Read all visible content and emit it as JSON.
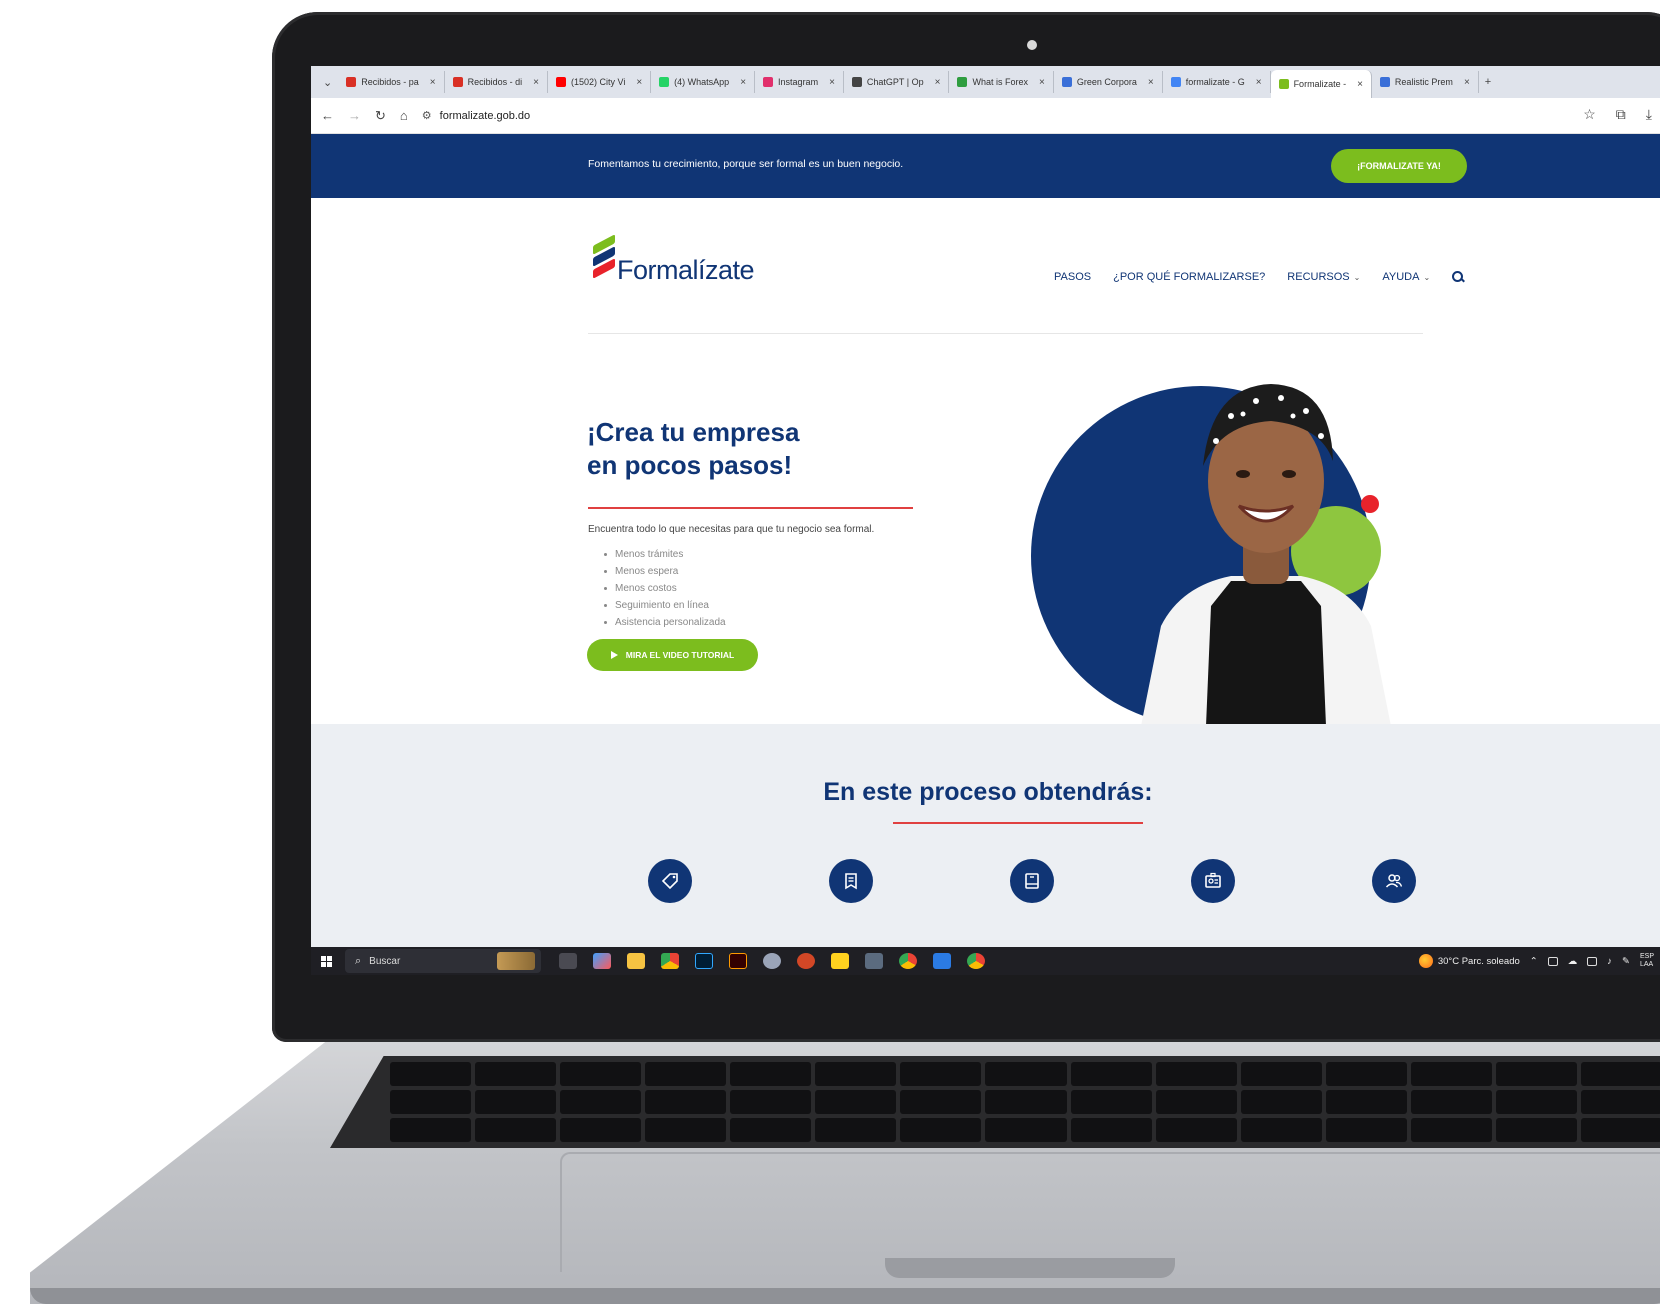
{
  "browser": {
    "tabs": [
      {
        "label": "Recibidos - pa",
        "color": "#d93025"
      },
      {
        "label": "Recibidos - di",
        "color": "#d93025"
      },
      {
        "label": "(1502) City Vi",
        "color": "#ff0000"
      },
      {
        "label": "(4) WhatsApp",
        "color": "#25d366"
      },
      {
        "label": "Instagram",
        "color": "#e1306c"
      },
      {
        "label": "ChatGPT | Op",
        "color": "#444444"
      },
      {
        "label": "What is Forex",
        "color": "#2e9d3f"
      },
      {
        "label": "Green Corpora",
        "color": "#3a6fd8"
      },
      {
        "label": "formalizate - G",
        "color": "#4285f4"
      },
      {
        "label": "Formalizate - ",
        "color": "#7cbd1e"
      },
      {
        "label": "Realistic Prem",
        "color": "#3a6fd8"
      }
    ],
    "active_tab_index": 9,
    "url": "formalizate.gob.do"
  },
  "site": {
    "topbar_text": "Fomentamos tu crecimiento, porque ser formal es un buen negocio.",
    "topbar_cta": "¡FORMALIZATE YA!",
    "logo_text": "Formalízate",
    "nav": [
      {
        "label": "PASOS",
        "dropdown": false
      },
      {
        "label": "¿POR QUÉ FORMALIZARSE?",
        "dropdown": false
      },
      {
        "label": "RECURSOS",
        "dropdown": true
      },
      {
        "label": "AYUDA",
        "dropdown": true
      }
    ],
    "hero": {
      "title_line1": "¡Crea tu empresa",
      "title_line2": "en pocos pasos!",
      "intro": "Encuentra todo lo que necesitas para que tu negocio sea formal.",
      "benefits": [
        "Menos trámites",
        "Menos espera",
        "Menos costos",
        "Seguimiento en línea",
        "Asistencia personalizada"
      ],
      "video_button": "MIRA EL VIDEO TUTORIAL"
    },
    "section": {
      "title": "En este proceso obtendrás:",
      "icons": [
        "tag-icon",
        "receipt-icon",
        "book-icon",
        "id-card-icon",
        "users-icon"
      ]
    },
    "colors": {
      "brand_blue": "#103575",
      "brand_green": "#7cbd1e",
      "accent_red": "#e04040"
    }
  },
  "taskbar": {
    "search_label": "Buscar",
    "weather": "30°C  Parc. soleado",
    "lang_line1": "ESP",
    "lang_line2": "LAA"
  }
}
